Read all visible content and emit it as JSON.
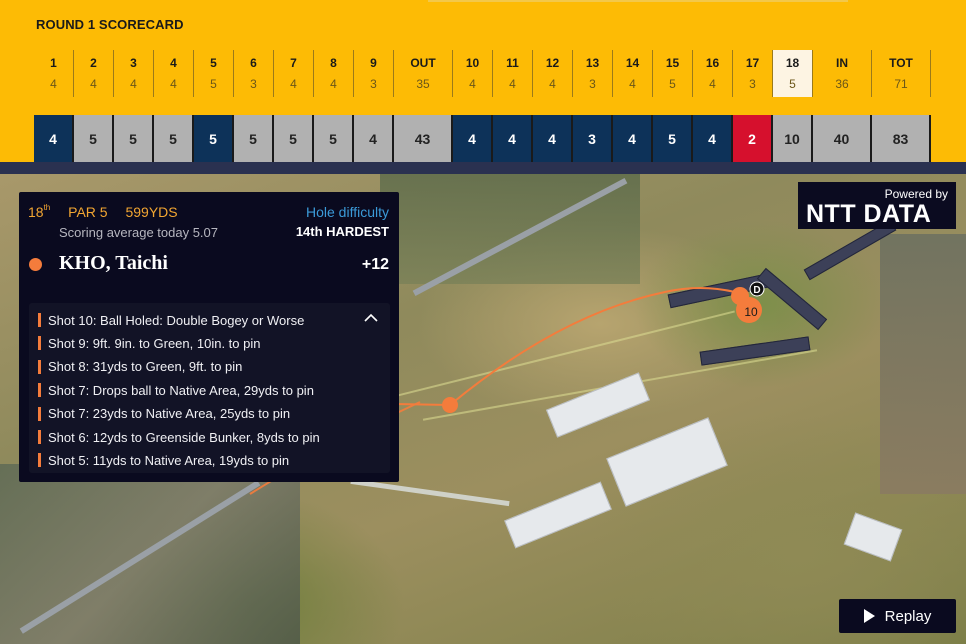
{
  "scorecard": {
    "title": "ROUND 1 SCORECARD",
    "columns": [
      {
        "hole": "1",
        "par": "4",
        "score": "4",
        "style": "navy"
      },
      {
        "hole": "2",
        "par": "4",
        "score": "5",
        "style": "grey"
      },
      {
        "hole": "3",
        "par": "4",
        "score": "5",
        "style": "grey"
      },
      {
        "hole": "4",
        "par": "4",
        "score": "5",
        "style": "grey"
      },
      {
        "hole": "5",
        "par": "5",
        "score": "5",
        "style": "navy"
      },
      {
        "hole": "6",
        "par": "3",
        "score": "5",
        "style": "grey"
      },
      {
        "hole": "7",
        "par": "4",
        "score": "5",
        "style": "grey"
      },
      {
        "hole": "8",
        "par": "4",
        "score": "5",
        "style": "grey"
      },
      {
        "hole": "9",
        "par": "3",
        "score": "4",
        "style": "grey"
      },
      {
        "hole": "OUT",
        "par": "35",
        "score": "43",
        "style": "grey",
        "wide": true
      },
      {
        "hole": "10",
        "par": "4",
        "score": "4",
        "style": "navy"
      },
      {
        "hole": "11",
        "par": "4",
        "score": "4",
        "style": "navy"
      },
      {
        "hole": "12",
        "par": "4",
        "score": "4",
        "style": "navy"
      },
      {
        "hole": "13",
        "par": "3",
        "score": "3",
        "style": "navy"
      },
      {
        "hole": "14",
        "par": "4",
        "score": "4",
        "style": "navy"
      },
      {
        "hole": "15",
        "par": "5",
        "score": "5",
        "style": "navy"
      },
      {
        "hole": "16",
        "par": "4",
        "score": "4",
        "style": "navy"
      },
      {
        "hole": "17",
        "par": "3",
        "score": "2",
        "style": "red"
      },
      {
        "hole": "18",
        "par": "5",
        "score": "10",
        "style": "grey",
        "current": true
      },
      {
        "hole": "IN",
        "par": "36",
        "score": "40",
        "style": "grey",
        "wide": true
      },
      {
        "hole": "TOT",
        "par": "71",
        "score": "83",
        "style": "grey",
        "wide": true
      }
    ]
  },
  "hole_info": {
    "hole_number": "18",
    "hole_suffix": "th",
    "par": "PAR 5",
    "yards": "599YDS",
    "scoring_average": "Scoring average today 5.07",
    "difficulty_label": "Hole difficulty",
    "difficulty_value": "14th HARDEST"
  },
  "player": {
    "name": "KHO, Taichi",
    "score": "+12",
    "color": "#f47c3c"
  },
  "shots": [
    "Shot 10: Ball Holed: Double Bogey or Worse",
    "Shot 9: 9ft. 9in. to Green, 10in. to pin",
    "Shot 8: 31yds to Green, 9ft. to pin",
    "Shot 7: Drops ball to Native Area, 29yds to pin",
    "Shot 7: 23yds to Native Area, 25yds to pin",
    "Shot 6: 12yds to Greenside Bunker, 8yds to pin",
    "Shot 5: 11yds to Native Area, 19yds to pin"
  ],
  "map": {
    "ball_marker_label": "10",
    "drop_marker_label": "D"
  },
  "sponsor": {
    "powered_by": "Powered by",
    "brand": "NTT DATA"
  },
  "controls": {
    "replay_label": "Replay"
  },
  "colors": {
    "scorecard_bg": "#FDBB05",
    "birdie": "#d6102d",
    "par": "#0d3259",
    "bogey": "#b1b1b1",
    "shot_accent": "#f47c3c",
    "difficulty_accent": "#3b9ad8"
  }
}
